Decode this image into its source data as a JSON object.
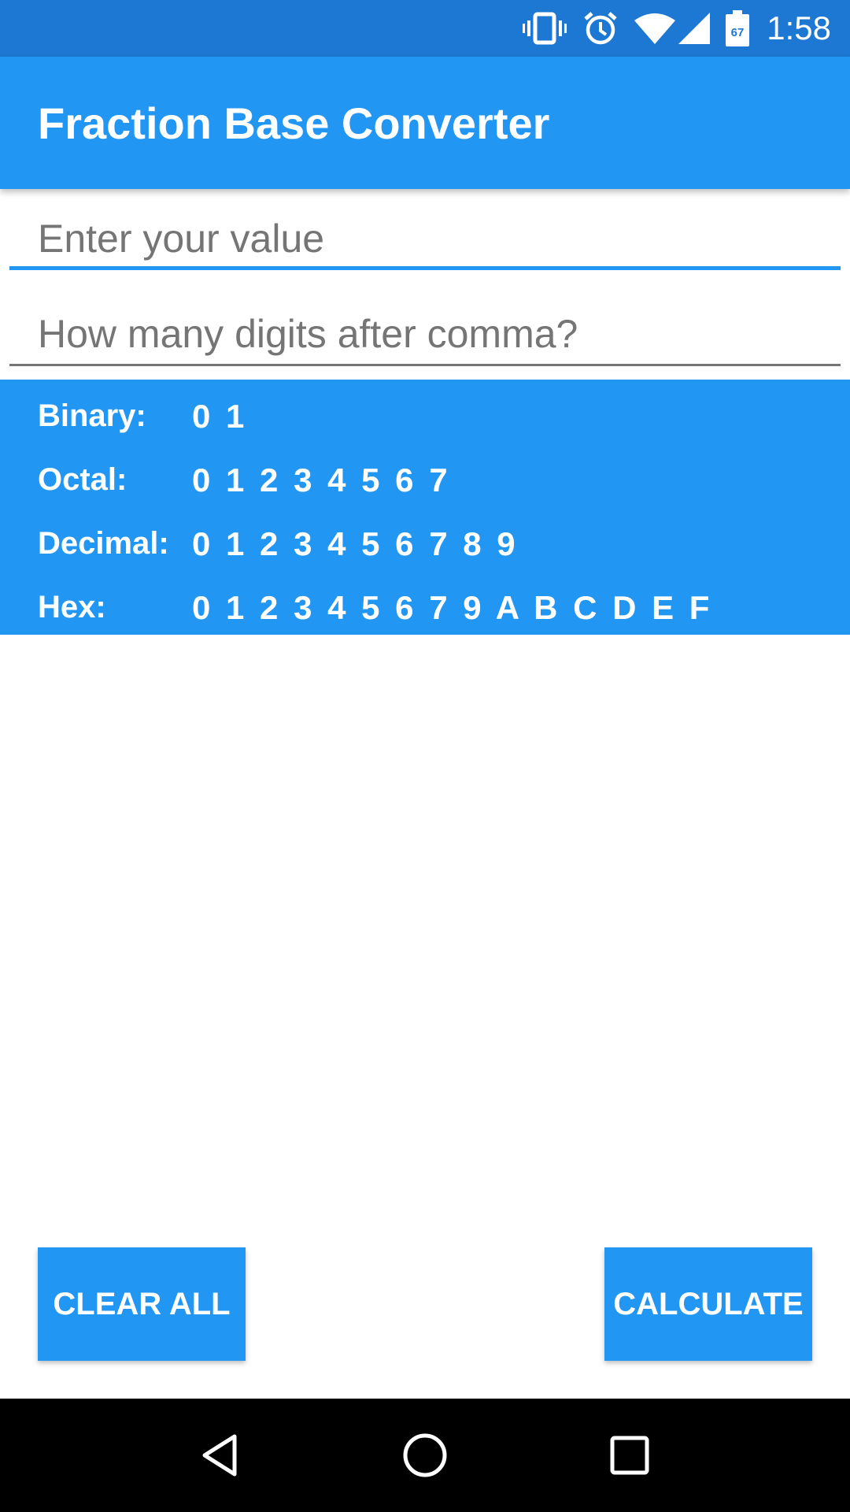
{
  "status_bar": {
    "time": "1:58",
    "icons": [
      "vibrate-icon",
      "alarm-icon",
      "wifi-icon",
      "signal-icon",
      "battery-icon"
    ],
    "battery_level": "67"
  },
  "app_bar": {
    "title": "Fraction Base Converter",
    "color": "#2196f3"
  },
  "inputs": {
    "value": {
      "placeholder": "Enter your value",
      "value": ""
    },
    "digits": {
      "placeholder": "How many digits after comma?",
      "value": ""
    }
  },
  "bases": [
    {
      "label": "Binary:",
      "digits": "0 1"
    },
    {
      "label": "Octal:",
      "digits": "0 1 2 3 4 5 6 7"
    },
    {
      "label": "Decimal:",
      "digits": "0 1 2 3 4 5 6 7 8 9"
    },
    {
      "label": "Hex:",
      "digits": "0 1 2 3 4 5 6 7 9 A B C D E F"
    }
  ],
  "buttons": {
    "clear_label": "CLEAR ALL",
    "calculate_label": "CALCULATE"
  },
  "nav_bar": {
    "icons": [
      "back-icon",
      "home-icon",
      "recents-icon"
    ]
  }
}
